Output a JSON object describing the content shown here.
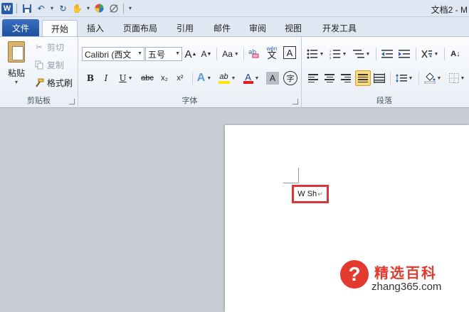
{
  "titlebar": {
    "title": "文档2 - M"
  },
  "tabs": {
    "file": "文件",
    "items": [
      "开始",
      "插入",
      "页面布局",
      "引用",
      "邮件",
      "审阅",
      "视图",
      "开发工具"
    ]
  },
  "clipboard": {
    "paste": "粘贴",
    "cut": "剪切",
    "copy": "复制",
    "format_painter": "格式刷",
    "group_label": "剪贴板"
  },
  "font": {
    "name": "Calibri (西文",
    "size": "五号",
    "group_label": "字体",
    "grow": "A",
    "shrink": "A",
    "case": "Aa",
    "bold": "B",
    "italic": "I",
    "underline": "U",
    "strike": "abc",
    "subscript": "x₂",
    "superscript": "x²",
    "text_effect": "A",
    "highlight": "ab",
    "font_color": "A",
    "char_shading": "A",
    "enclose": "字",
    "phonetic": "wén",
    "border": "A"
  },
  "paragraph": {
    "group_label": "段落",
    "sort": "A↓"
  },
  "document": {
    "typed_text": "W Sh"
  },
  "watermark": {
    "badge": "?",
    "site_name": "精选百科",
    "url": "zhang365.com"
  },
  "colors": {
    "file_tab": "#2a5aa8",
    "highlight_box": "#d9363a",
    "selected_align": "#f9d97a",
    "font_color_bar": "#e02020",
    "highlight_bar": "#ffe500"
  }
}
